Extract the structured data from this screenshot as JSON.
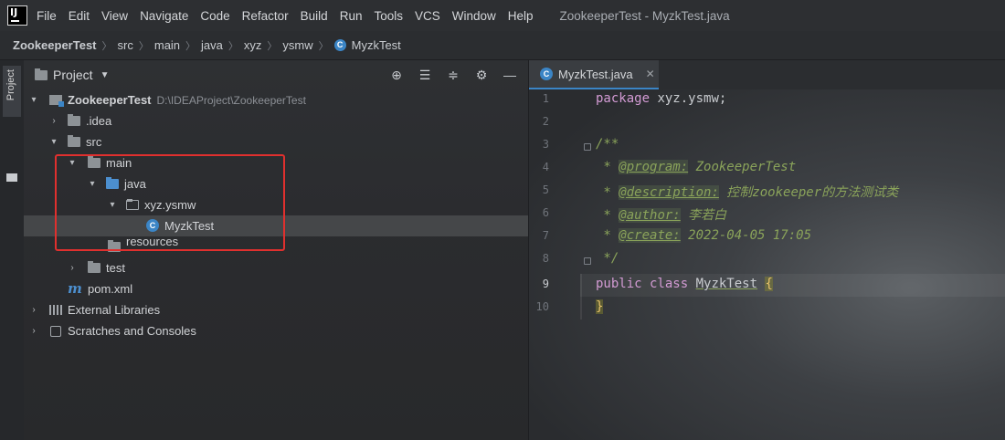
{
  "menubar": {
    "items": [
      "File",
      "Edit",
      "View",
      "Navigate",
      "Code",
      "Refactor",
      "Build",
      "Run",
      "Tools",
      "VCS",
      "Window",
      "Help"
    ],
    "window_title": "ZookeeperTest - MyzkTest.java"
  },
  "breadcrumbs": [
    "ZookeeperTest",
    "src",
    "main",
    "java",
    "xyz",
    "ysmw",
    "MyzkTest"
  ],
  "tool_stripe": {
    "project_tab": "Project"
  },
  "project_panel": {
    "title": "Project",
    "tree": {
      "root_name": "ZookeeperTest",
      "root_path": "D:\\IDEAProject\\ZookeeperTest",
      "idea": ".idea",
      "src": "src",
      "main": "main",
      "java": "java",
      "package": "xyz.ysmw",
      "class": "MyzkTest",
      "resources": "resources",
      "test": "test",
      "pom": "pom.xml",
      "external_libraries": "External Libraries",
      "scratches": "Scratches and Consoles"
    }
  },
  "editor": {
    "tab_label": "MyzkTest.java",
    "line_numbers": [
      "1",
      "2",
      "3",
      "4",
      "5",
      "6",
      "7",
      "8",
      "9",
      "10"
    ],
    "code": {
      "package_kw": "package",
      "package_name": " xyz.ysmw;",
      "doc_open": "/**",
      "star": " * ",
      "program_tag": "@program:",
      "program_val": " ZookeeperTest",
      "description_tag": "@description:",
      "description_val": " 控制zookeeper的方法测试类",
      "author_tag": "@author:",
      "author_val": " 李若白",
      "create_tag": "@create:",
      "create_val": " 2022-04-05 17:05",
      "doc_close": " */",
      "public_kw": "public",
      "class_kw": " class ",
      "class_name": "MyzkTest",
      "open_brace": "{",
      "close_brace": "}"
    }
  },
  "colors": {
    "accent": "#3b85c6",
    "highlight_box": "#e0302e",
    "keyword": "#d39bd4",
    "doc_comment": "#8aa35a"
  }
}
